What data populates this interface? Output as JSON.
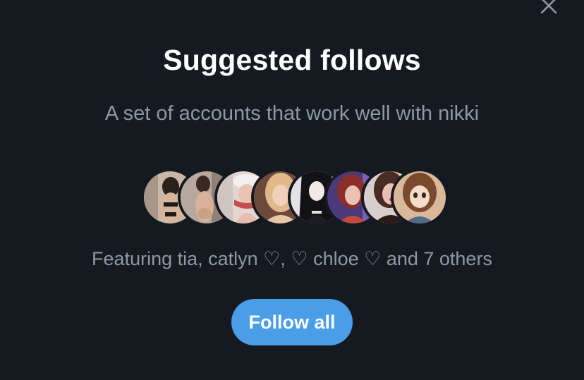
{
  "dialog": {
    "close_icon": "close-icon",
    "title": "Suggested follows",
    "subtitle": "A set of accounts that work well with nikki",
    "featuring_text": "Featuring tia, catlyn ♡, ♡ chloe ♡ and 7 others",
    "follow_all_label": "Follow all"
  },
  "avatars": [
    {
      "name": "avatar-1",
      "bg": "#c9b8a8",
      "fg": "#3a2a22"
    },
    {
      "name": "avatar-2",
      "bg": "#b7a9a0",
      "fg": "#d8b39a"
    },
    {
      "name": "avatar-3",
      "bg": "#e4d7d2",
      "fg": "#c44d4d"
    },
    {
      "name": "avatar-4",
      "bg": "#6b4a3a",
      "fg": "#e1b88a"
    },
    {
      "name": "avatar-5",
      "bg": "#2a2b35",
      "fg": "#e9e0dc"
    },
    {
      "name": "avatar-6",
      "bg": "#4a3a7a",
      "fg": "#c24b3f"
    },
    {
      "name": "avatar-7",
      "bg": "#5a4140",
      "fg": "#e7c2b4"
    },
    {
      "name": "avatar-8",
      "bg": "#d9b99a",
      "fg": "#6b3f2a"
    }
  ],
  "colors": {
    "background": "#151a21",
    "accent": "#4a9ee8",
    "muted_text": "#8b98a5"
  }
}
